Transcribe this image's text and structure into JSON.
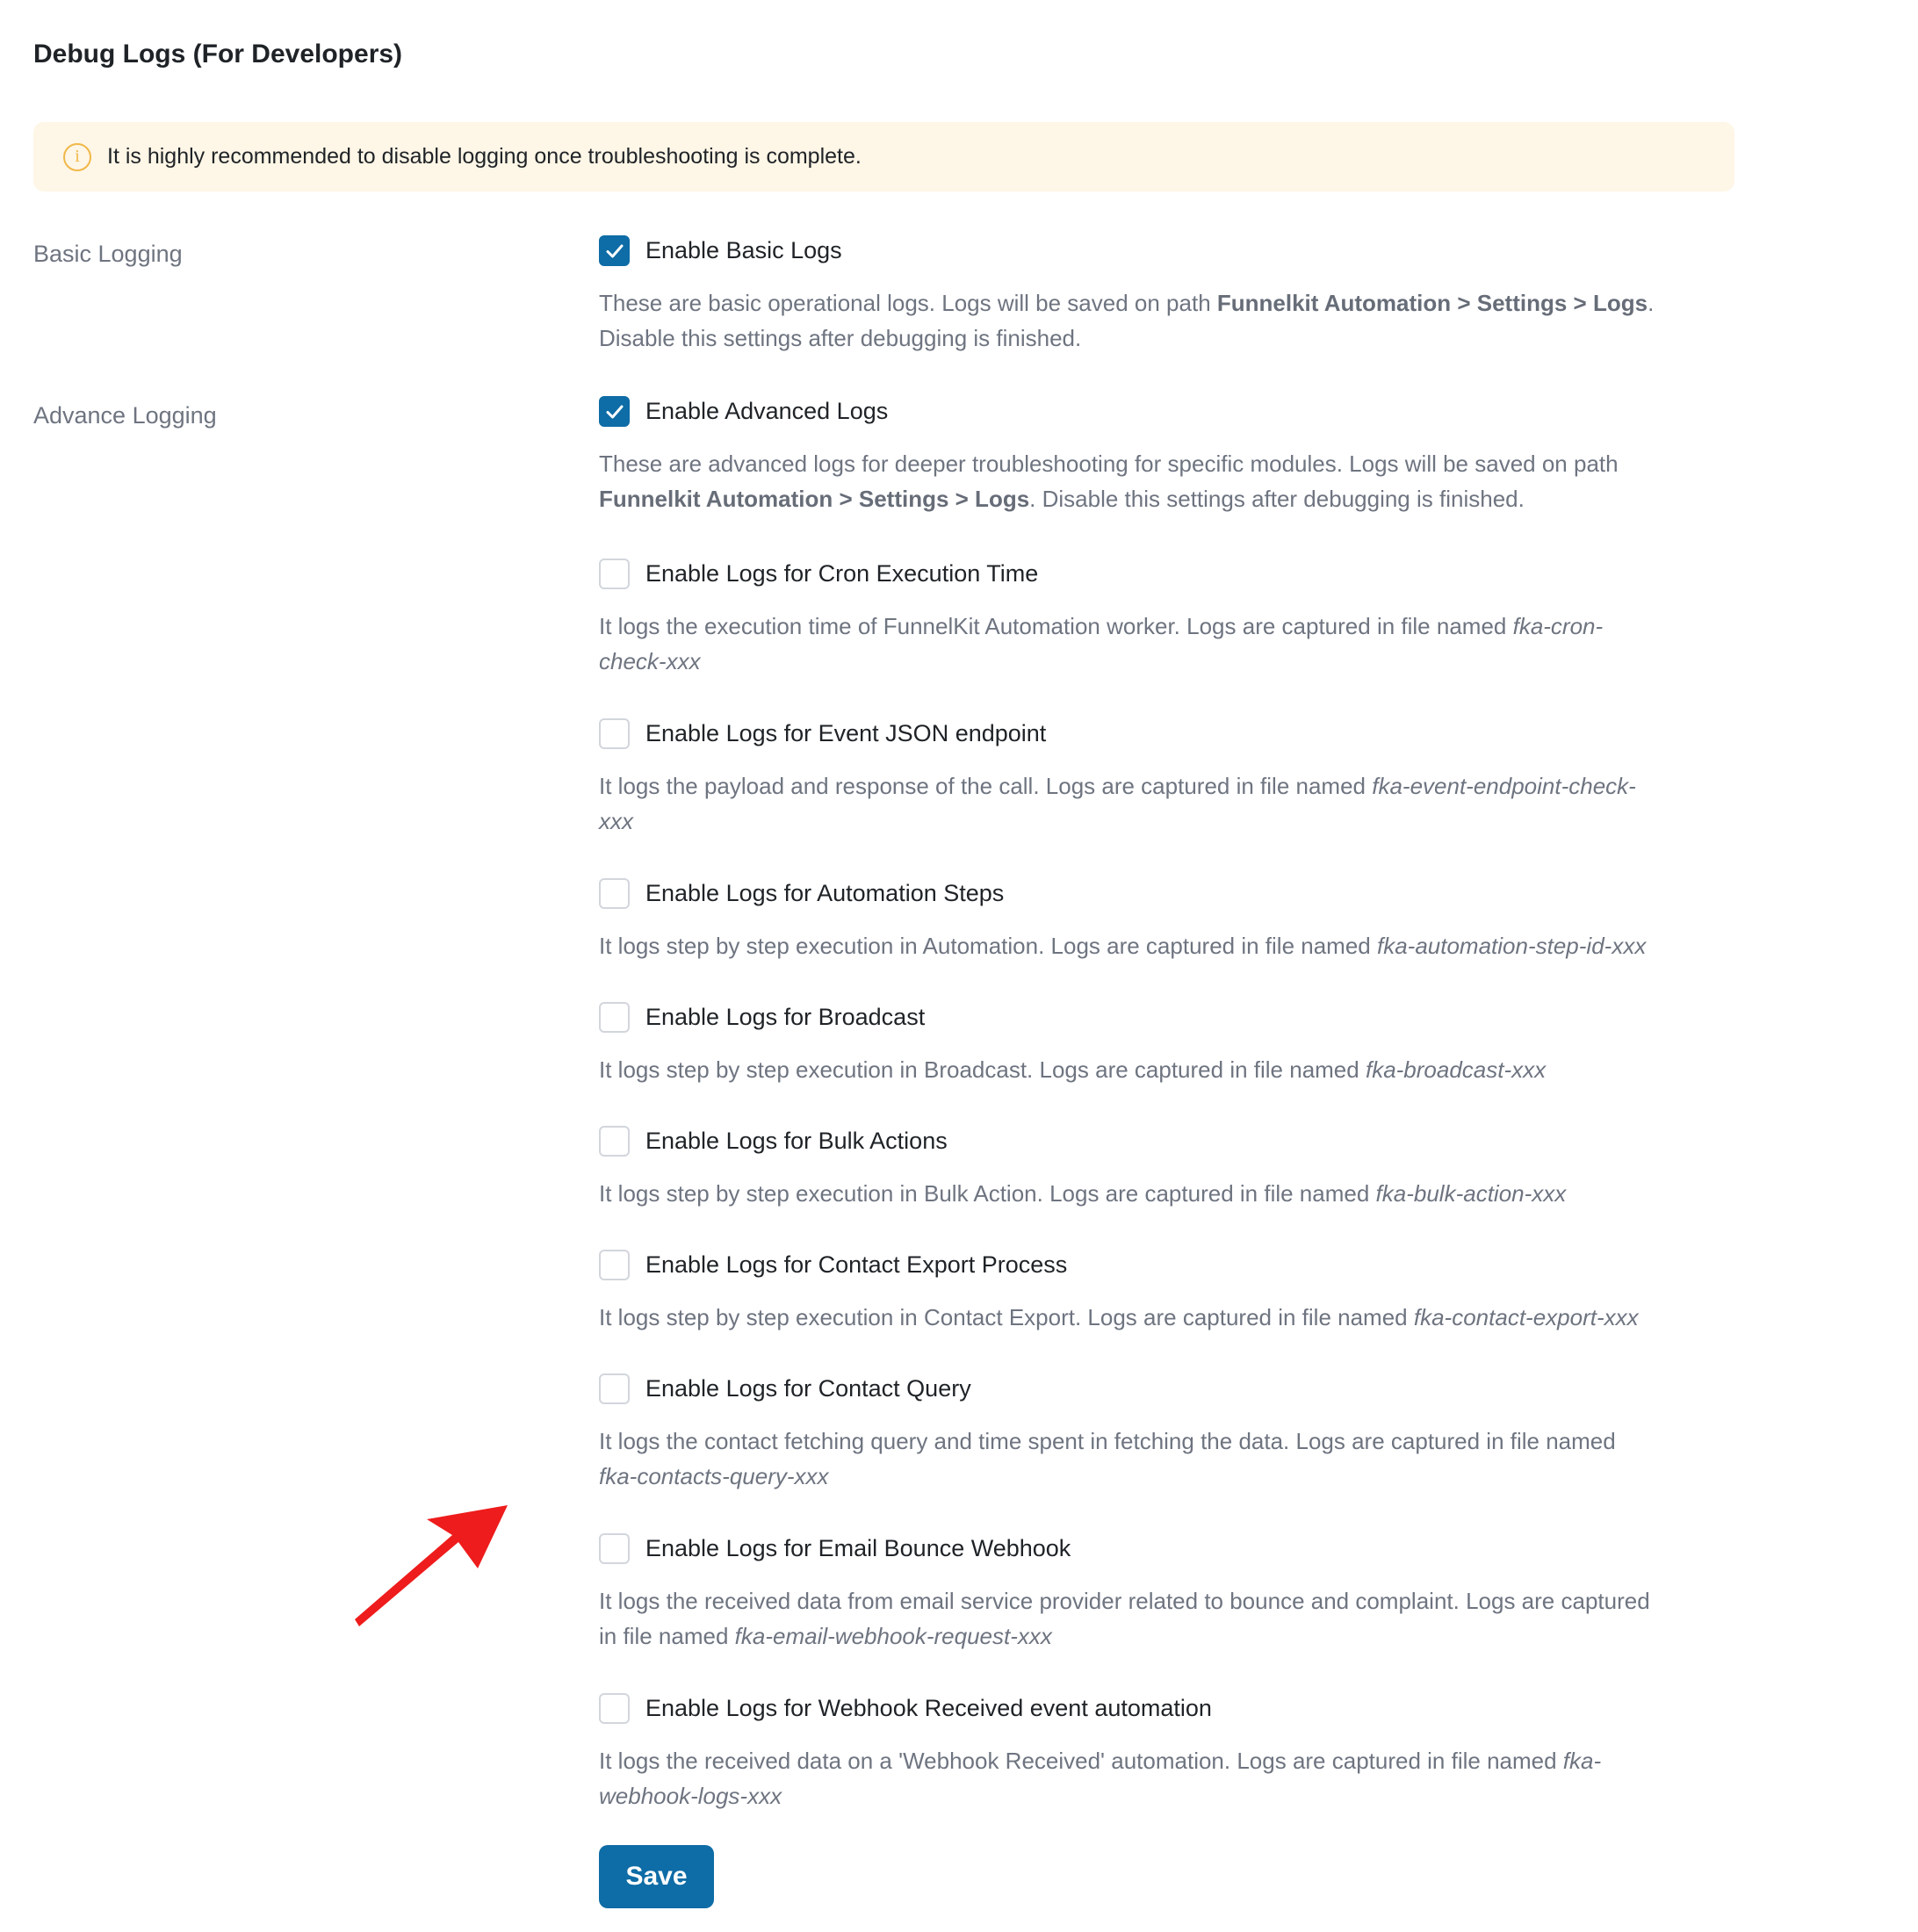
{
  "title": "Debug Logs (For Developers)",
  "notice": {
    "icon": "info-icon",
    "text": "It is highly recommended to disable logging once troubleshooting is complete.",
    "color": "#f0b849",
    "background": "#fef6e6"
  },
  "sections": {
    "basic": {
      "label": "Basic Logging"
    },
    "advance": {
      "label": "Advance Logging"
    }
  },
  "options": {
    "basic": {
      "label": "Enable Basic Logs",
      "checked": true,
      "desc_a": "These are basic operational logs. Logs will be saved on path ",
      "desc_bold": "Funnelkit Automation > Settings > Logs",
      "desc_b": ".",
      "desc_c": "Disable this settings after debugging is finished."
    },
    "advanced": {
      "label": "Enable Advanced Logs",
      "checked": true,
      "desc_a": "These are advanced logs for deeper troubleshooting for specific modules. Logs will be saved on path",
      "desc_bold": "Funnelkit Automation > Settings > Logs",
      "desc_b": ". Disable this settings after debugging is finished."
    },
    "cron": {
      "label": "Enable Logs for Cron Execution Time",
      "checked": false,
      "desc": "It logs the execution time of FunnelKit Automation worker. Logs are captured in file named ",
      "file_a": "fka-cron-",
      "file_b": "check-xxx"
    },
    "event_json": {
      "label": "Enable Logs for Event JSON endpoint",
      "checked": false,
      "desc": "It logs the payload and response of the call. Logs are captured in file named ",
      "file_a": "fka-event-endpoint-check-",
      "file_b": "xxx"
    },
    "automation_steps": {
      "label": "Enable Logs for Automation Steps",
      "checked": false,
      "desc": "It logs step by step execution in Automation. Logs are captured in file named ",
      "file": "fka-automation-step-id-xxx"
    },
    "broadcast": {
      "label": "Enable Logs for Broadcast",
      "checked": false,
      "desc": "It logs step by step execution in Broadcast. Logs are captured in file named ",
      "file": "fka-broadcast-xxx"
    },
    "bulk_actions": {
      "label": "Enable Logs for Bulk Actions",
      "checked": false,
      "desc": "It logs step by step execution in Bulk Action. Logs are captured in file named ",
      "file": "fka-bulk-action-xxx"
    },
    "contact_export": {
      "label": "Enable Logs for Contact Export Process",
      "checked": false,
      "desc": "It logs step by step execution in Contact Export. Logs are captured in file named ",
      "file": "fka-contact-export-xxx"
    },
    "contact_query": {
      "label": "Enable Logs for Contact Query",
      "checked": false,
      "desc": "It logs the contact fetching query and time spent in fetching the data. Logs are captured in file named",
      "file": "fka-contacts-query-xxx"
    },
    "email_bounce": {
      "label": "Enable Logs for Email Bounce Webhook",
      "checked": false,
      "desc_a": "It logs the received data from email service provider related to bounce and complaint. Logs are captured",
      "desc_b": "in file named ",
      "file": "fka-email-webhook-request-xxx"
    },
    "webhook_received": {
      "label": "Enable Logs for Webhook Received event automation",
      "checked": false,
      "desc": "It logs the received data on a 'Webhook Received' automation. Logs are captured in file named ",
      "file_a": "fka-",
      "file_b": "webhook-logs-xxx"
    }
  },
  "save_button": {
    "label": "Save",
    "color": "#0e6ca6"
  },
  "annotation": {
    "icon": "red-arrow-icon",
    "color": "#ee1c1c"
  }
}
